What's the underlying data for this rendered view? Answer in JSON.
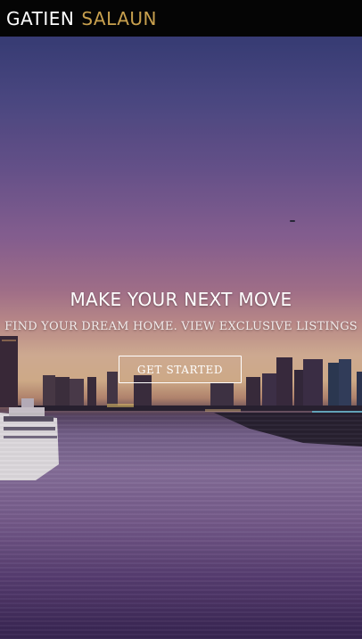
{
  "header": {
    "brand_first": "GATIEN",
    "brand_last": "SALAUN"
  },
  "hero": {
    "title": "MAKE YOUR NEXT MOVE",
    "subtitle": "FIND YOUR DREAM HOME. VIEW EXCLUSIVE LISTINGS",
    "cta_label": "GET STARTED",
    "background_image": "sunset-city-skyline-waterfront"
  },
  "colors": {
    "header_bg": "#050505",
    "brand_accent": "#c8a04e",
    "text": "#ffffff"
  }
}
